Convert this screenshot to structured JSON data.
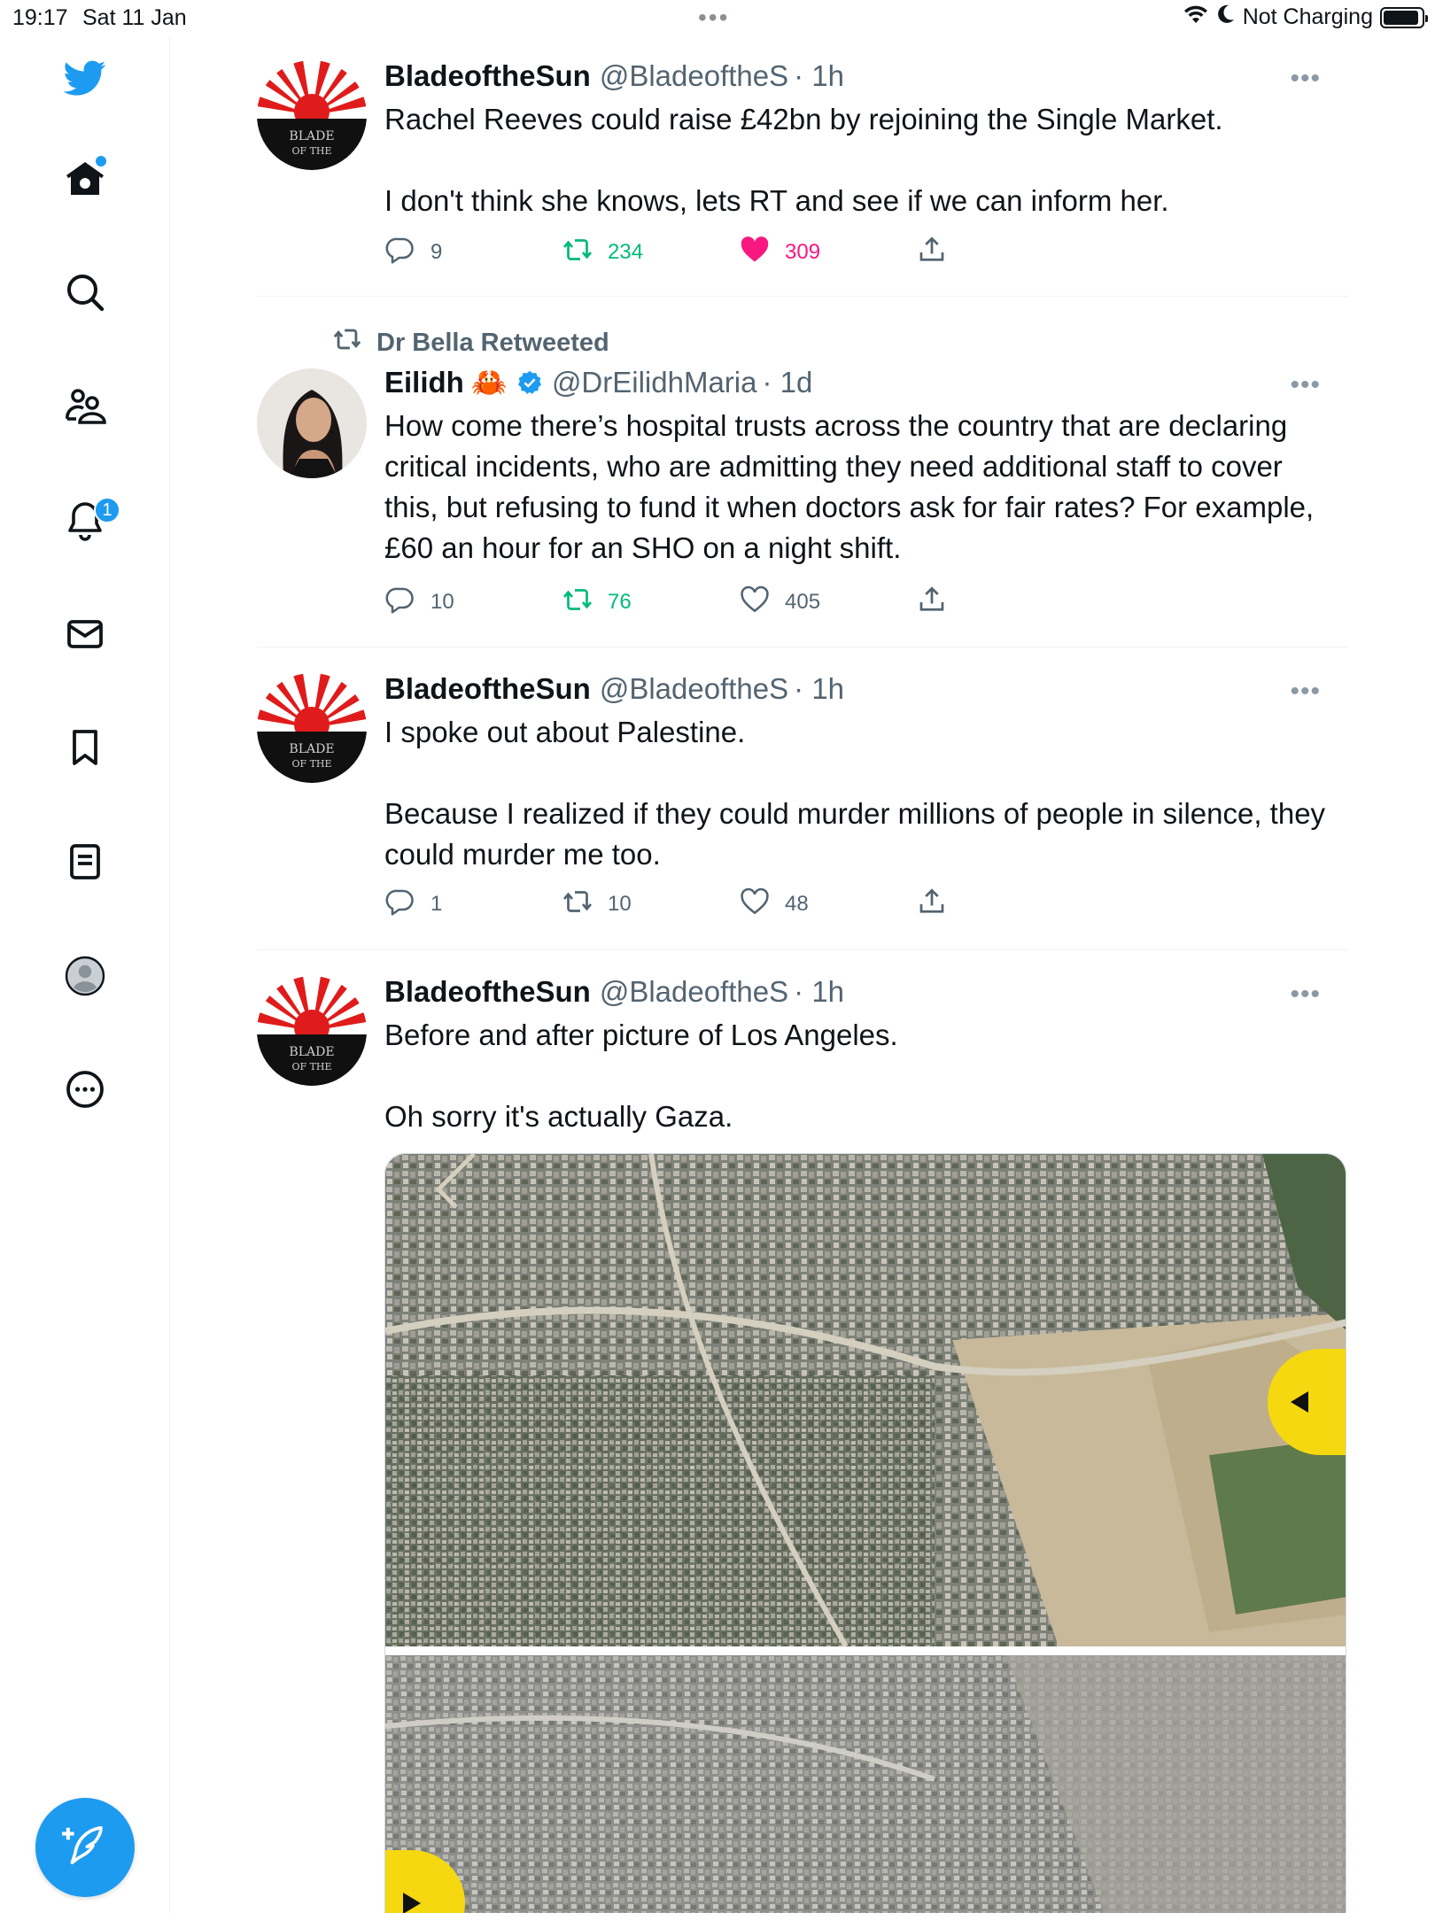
{
  "status_bar": {
    "time": "19:17",
    "date": "Sat 11 Jan",
    "dots": "•••",
    "charging": "Not Charging"
  },
  "sidebar": {
    "items": [
      {
        "icon": "twitter-bird-icon"
      },
      {
        "icon": "home-icon"
      },
      {
        "icon": "search-icon"
      },
      {
        "icon": "communities-icon"
      },
      {
        "icon": "notifications-bell-icon",
        "badge": "1"
      },
      {
        "icon": "messages-icon"
      },
      {
        "icon": "bookmarks-icon"
      },
      {
        "icon": "lists-icon"
      },
      {
        "icon": "profile-icon"
      },
      {
        "icon": "more-circle-icon"
      }
    ]
  },
  "tweets": [
    {
      "name": "BladeoftheSun",
      "handle": "@BladeoftheS",
      "time": "· 1h",
      "more": "•••",
      "text": [
        "Rachel Reeves could raise £42bn by rejoining the Single Market.",
        "I don't think she knows, lets RT and see if we can inform her."
      ],
      "replies": "9",
      "retweets": "234",
      "likes": "309"
    },
    {
      "retweeted_by": "Dr Bella Retweeted",
      "name": "Eilidh",
      "emoji": "🦀",
      "handle": "@DrEilidhMaria",
      "time": "· 1d",
      "more": "•••",
      "text": [
        "How come there’s hospital trusts across the country that are declaring critical incidents, who are admitting they need additional staff to cover this, but refusing to fund it when doctors ask for fair rates? For example, £60 an hour for an SHO on a night shift."
      ],
      "replies": "10",
      "retweets": "76",
      "likes": "405"
    },
    {
      "name": "BladeoftheSun",
      "handle": "@BladeoftheS",
      "time": "· 1h",
      "more": "•••",
      "text": [
        "I spoke out about Palestine.",
        "Because I realized if they could murder millions of people in silence, they could murder me too."
      ],
      "replies": "1",
      "retweets": "10",
      "likes": "48"
    },
    {
      "name": "BladeoftheSun",
      "handle": "@BladeoftheS",
      "time": "· 1h",
      "more": "•••",
      "text": [
        "Before and after picture of Los Angeles.",
        "Oh sorry it's actually Gaza."
      ]
    }
  ],
  "colors": {
    "accent": "#1d9bf0",
    "retweet_green": "#00ba7c",
    "like_pink": "#f91880",
    "secondary_text": "#536471"
  }
}
